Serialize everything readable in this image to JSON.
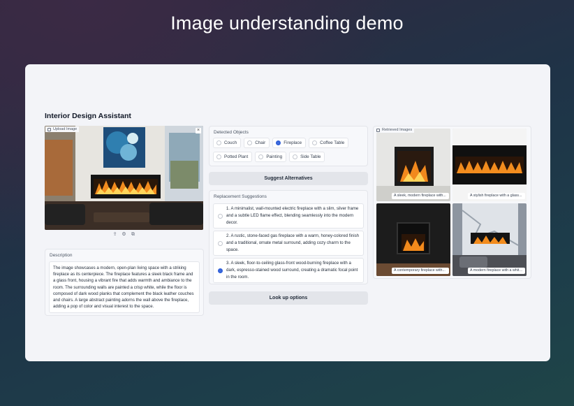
{
  "header": {
    "title": "Image understanding demo"
  },
  "app": {
    "title": "Interior Design Assistant"
  },
  "upload": {
    "label": "Upload Image",
    "close": "×"
  },
  "description": {
    "label": "Description",
    "text": "The image showcases a modern, open-plan living space with a striking fireplace as its centerpiece. The fireplace features a sleek black frame and a glass front, housing a vibrant fire that adds warmth and ambiance to the room. The surrounding walls are painted a crisp white, while the floor is composed of dark wood planks that complement the black leather couches and chairs. A large abstract painting adorns the wall above the fireplace, adding a pop of color and visual interest to the space."
  },
  "detected": {
    "label": "Detected Objects",
    "options": [
      {
        "label": "Couch",
        "selected": false
      },
      {
        "label": "Chair",
        "selected": false
      },
      {
        "label": "Fireplace",
        "selected": true
      },
      {
        "label": "Coffee Table",
        "selected": false
      },
      {
        "label": "Potted Plant",
        "selected": false
      },
      {
        "label": "Painting",
        "selected": false
      },
      {
        "label": "Side Table",
        "selected": false
      }
    ]
  },
  "suggest_button": "Suggest Alternatives",
  "replacements": {
    "label": "Replacement Suggestions",
    "items": [
      {
        "text": "1. A minimalist, wall-mounted electric fireplace with a slim, silver frame and a subtle LED flame effect, blending seamlessly into the modern decor.",
        "selected": false
      },
      {
        "text": "2. A rustic, stone-faced gas fireplace with a warm, honey-colored finish and a traditional, ornate metal surround, adding cozy charm to the space.",
        "selected": false
      },
      {
        "text": "3. A sleek, floor-to-ceiling glass-front wood-burning fireplace with a dark, espresso-stained wood surround, creating a dramatic focal point in the room.",
        "selected": true
      }
    ]
  },
  "lookup_button": "Look up options",
  "retrieved": {
    "label": "Retrieved Images",
    "images": [
      {
        "caption": "A sleek, modern fireplace with..."
      },
      {
        "caption": "A stylish fireplace with a glass..."
      },
      {
        "caption": "A contemporary fireplace with..."
      },
      {
        "caption": "A modern fireplace with a white..."
      }
    ]
  }
}
